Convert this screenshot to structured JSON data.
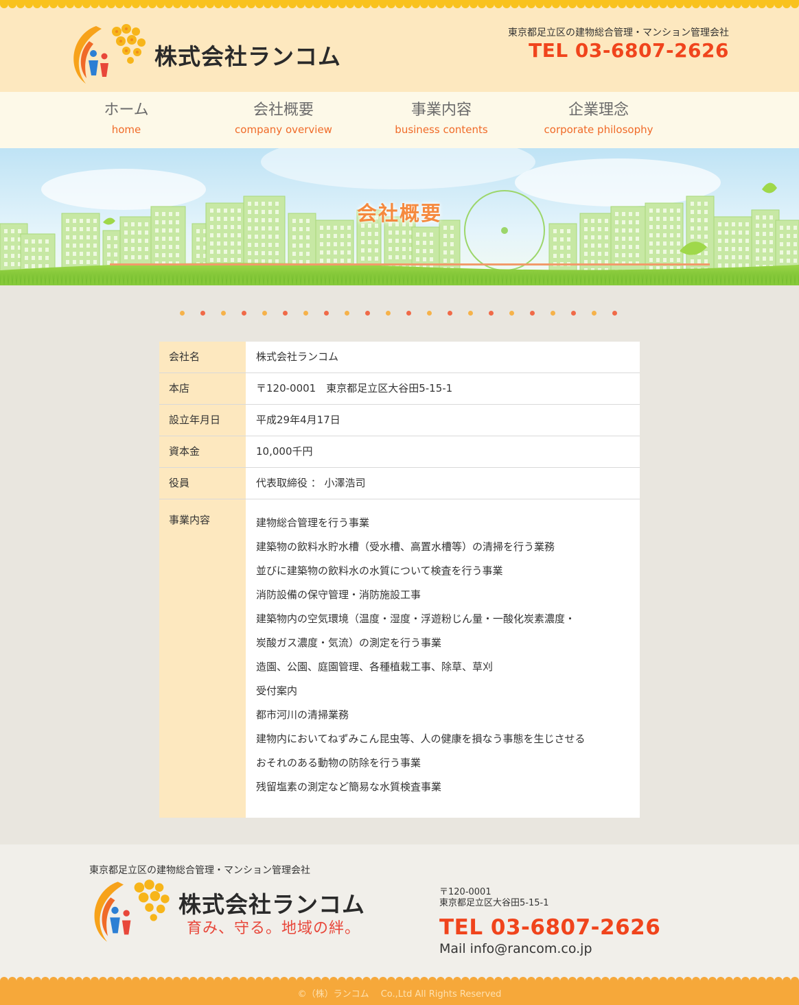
{
  "header": {
    "company_name": "株式会社ランコム",
    "tagline": "東京都足立区の建物総合管理・マンション管理会社",
    "tel": "TEL 03-6807-2626"
  },
  "nav": {
    "items": [
      {
        "jp": "ホーム",
        "en": "home"
      },
      {
        "jp": "会社概要",
        "en": "company overview"
      },
      {
        "jp": "事業内容",
        "en": "business contents"
      },
      {
        "jp": "企業理念",
        "en": "corporate philosophy"
      }
    ]
  },
  "banner": {
    "title": "会社概要"
  },
  "company_table": {
    "rows": [
      {
        "label": "会社名",
        "value": "株式会社ランコム"
      },
      {
        "label": "本店",
        "value": "〒120-0001　東京都足立区大谷田5-15-1"
      },
      {
        "label": "設立年月日",
        "value": "平成29年4月17日"
      },
      {
        "label": "資本金",
        "value": "10,000千円"
      },
      {
        "label": "役員",
        "value": "代表取締役 ： 小澤浩司"
      }
    ],
    "business": {
      "label": "事業内容",
      "lines": [
        "建物総合管理を行う事業",
        "建築物の飲料水貯水槽（受水槽、高置水槽等）の清掃を行う業務",
        "並びに建築物の飲料水の水質について検査を行う事業",
        "消防設備の保守管理・消防施設工事",
        "建築物内の空気環境（温度・湿度・浮遊粉じん量・一酸化炭素濃度・",
        "炭酸ガス濃度・気流）の測定を行う事業",
        "造園、公園、庭園管理、各種植栽工事、除草、草刈",
        "受付案内",
        "都市河川の清掃業務",
        "建物内においてねずみこん昆虫等、人の健康を損なう事態を生じさせる",
        "おそれのある動物の防除を行う事業",
        "残留塩素の測定など簡易な水質検査事業"
      ]
    }
  },
  "footer": {
    "tagline": "東京都足立区の建物総合管理・マンション管理会社",
    "company_name": "株式会社ランコム",
    "slogan": "育み、守る。地域の絆。",
    "zip": "〒120-0001",
    "address": "東京都足立区大谷田5-15-1",
    "tel": "TEL 03-6807-2626",
    "mail": "Mail info@rancom.co.jp",
    "copyright": "©（株）ランコム　 Co.,Ltd All Rights Reserved"
  },
  "colors": {
    "accent": "#f0441c",
    "header_bg": "#fde8bf",
    "nav_en": "#f06a28",
    "footer_bar": "#f6a83a"
  }
}
